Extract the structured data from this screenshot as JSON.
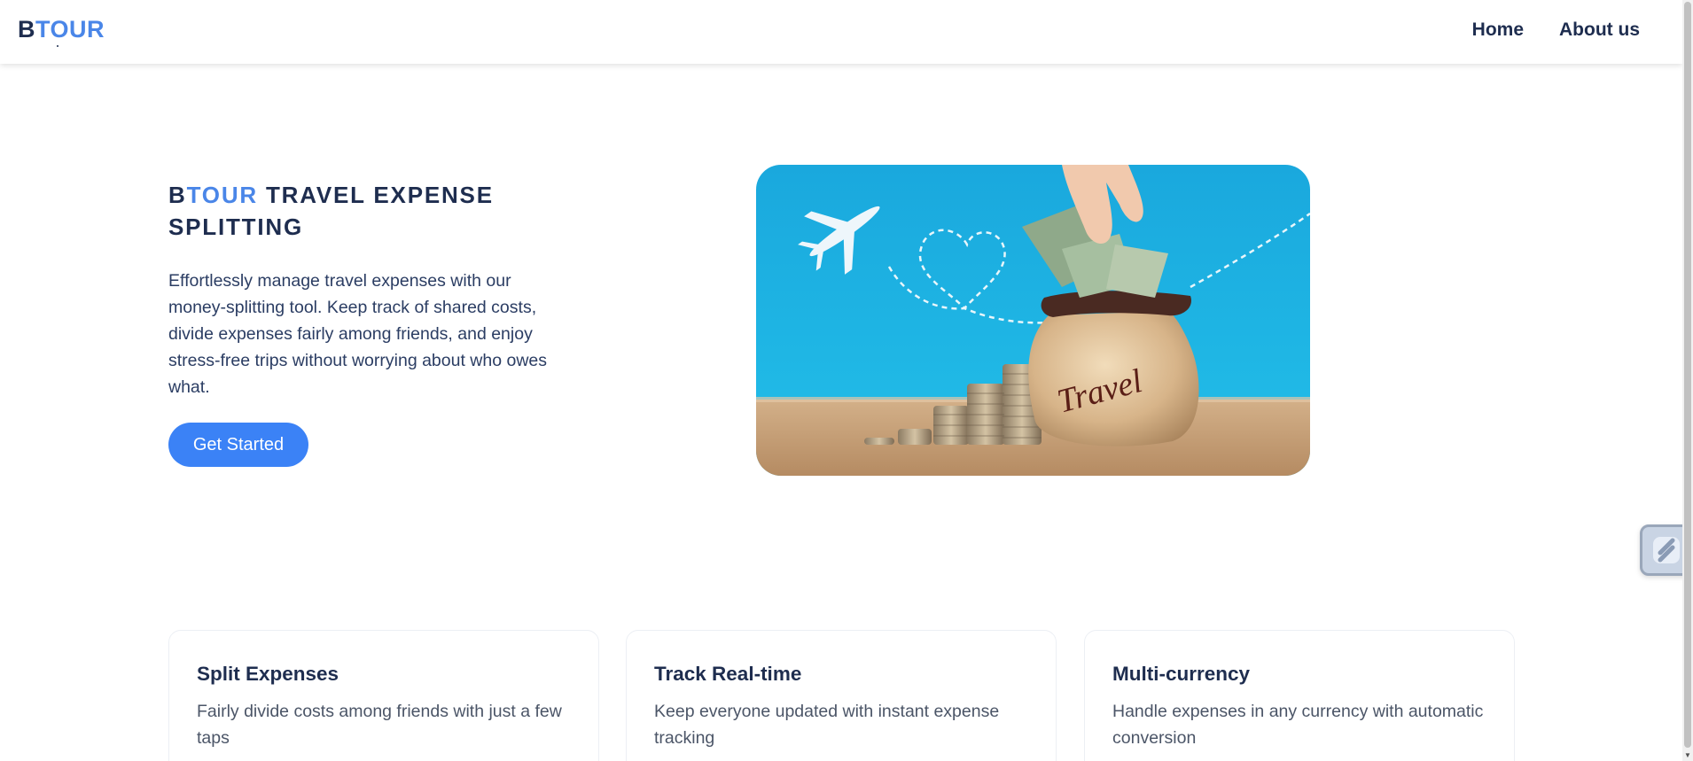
{
  "header": {
    "logo_b": "B",
    "logo_rest": "TOUR",
    "nav": [
      {
        "label": "Home"
      },
      {
        "label": "About us"
      }
    ]
  },
  "hero": {
    "title_b": "B",
    "title_accent": "TOUR",
    "title_rest": " TRAVEL EXPENSE SPLITTING",
    "description": "Effortlessly manage travel expenses with our money-splitting tool. Keep track of shared costs, divide expenses fairly among friends, and enjoy stress-free trips without worrying about who owes what.",
    "cta_label": "Get Started",
    "image_text": "Travel"
  },
  "features": [
    {
      "title": "Split Expenses",
      "description": "Fairly divide costs among friends with just a few taps"
    },
    {
      "title": "Track Real-time",
      "description": "Keep everyone updated with instant expense tracking"
    },
    {
      "title": "Multi-currency",
      "description": "Handle expenses in any currency with automatic conversion"
    }
  ],
  "colors": {
    "brand_dark": "#1e2d4f",
    "accent": "#4a86e8",
    "button": "#3b82f6",
    "sky": "#1eb4e6"
  },
  "icons": {
    "widget": "slash-widget-icon"
  }
}
